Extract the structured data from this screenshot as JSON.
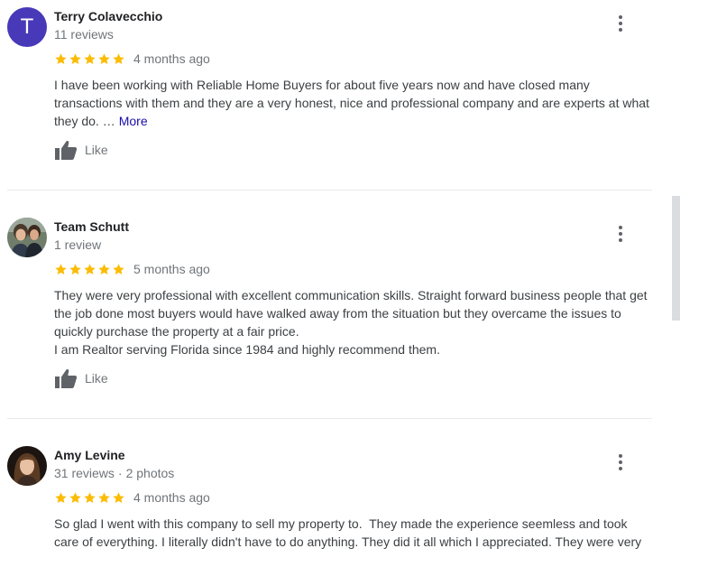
{
  "reviews": [
    {
      "name": "Terry Colavecchio",
      "avatar_letter": "T",
      "avatar_color": "#4839b8",
      "meta": "11 reviews",
      "rating": 5,
      "when": "4 months ago",
      "text": "I have been working with Reliable Home Buyers for about five years now and have closed many transactions with them and they are a very honest, nice and professional company and are experts at what they do. …",
      "more_label": "More",
      "like_label": "Like"
    },
    {
      "name": "Team Schutt",
      "avatar_icon": "profile-photo-icon",
      "meta": "1 review",
      "rating": 5,
      "when": "5 months ago",
      "text_line1": "They were very professional with excellent communication skills. Straight forward business people that get the job done most buyers would have walked away from the situation but they overcame the issues to quickly purchase the property at a fair price.",
      "text_line2": "I am Realtor serving Florida since 1984 and highly recommend them.",
      "like_label": "Like"
    },
    {
      "name": "Amy Levine",
      "avatar_icon": "profile-photo-icon",
      "meta_reviews": "31 reviews",
      "meta_sep": "·",
      "meta_photos": "2 photos",
      "rating": 5,
      "when": "4 months ago",
      "text": "So glad I went with this company to sell my property to.  They made the experience seemless and took care of everything. I literally didn't have to do anything. They did it all which I appreciated. They were very"
    }
  ],
  "colors": {
    "star": "#fbbc04",
    "link": "#1a0dab",
    "secondary_text": "#70757a",
    "icon": "#5f6368"
  },
  "icons": [
    "star-icon",
    "thumbs-up-icon",
    "more-vert-icon",
    "profile-photo-icon"
  ]
}
